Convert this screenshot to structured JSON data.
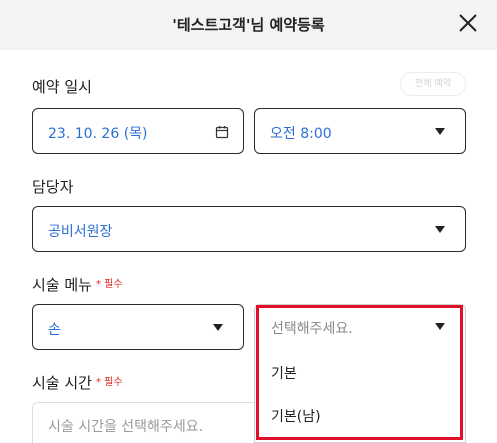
{
  "header": {
    "title": "'테스트고객'님 예약등록"
  },
  "reservation": {
    "label": "예약 일시",
    "ghost_button": "전체 예약",
    "date_value": "23. 10. 26 (목)",
    "time_value": "오전 8:00"
  },
  "staff": {
    "label": "담당자",
    "value": "공비서원장"
  },
  "menu": {
    "label": "시술 메뉴",
    "required": "* 필수",
    "category_value": "손",
    "item_placeholder": "선택해주세요.",
    "options": [
      "기본",
      "기본(남)"
    ]
  },
  "duration": {
    "label": "시술 시간",
    "required": "* 필수",
    "placeholder": "시술 시간을 선택해주세요."
  },
  "colors": {
    "accent": "#2b6fd6",
    "required": "#e02020",
    "highlight": "#e0102a"
  }
}
